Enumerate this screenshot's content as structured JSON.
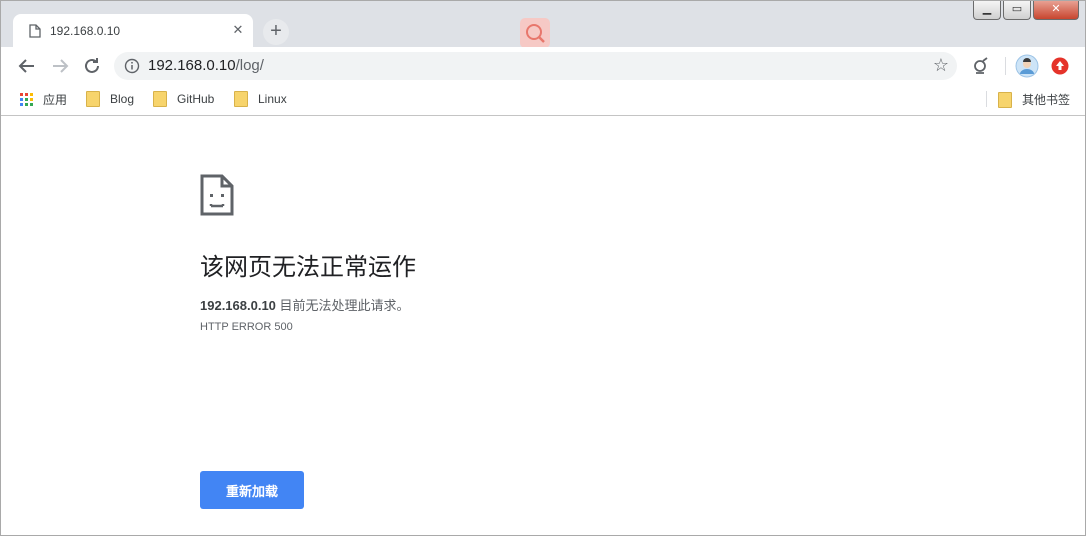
{
  "tab": {
    "title": "192.168.0.10"
  },
  "omnibox": {
    "host": "192.168.0.10",
    "path": "/log/"
  },
  "bookmarks": {
    "apps_label": "应用",
    "items": [
      {
        "label": "Blog"
      },
      {
        "label": "GitHub"
      },
      {
        "label": "Linux"
      }
    ],
    "other_label": "其他书签"
  },
  "error": {
    "title": "该网页无法正常运作",
    "host": "192.168.0.10",
    "message": "目前无法处理此请求。",
    "code": "HTTP ERROR 500",
    "reload_label": "重新加载"
  },
  "colors": {
    "accent": "#4285f4",
    "ext_badge": "#e5332a"
  }
}
